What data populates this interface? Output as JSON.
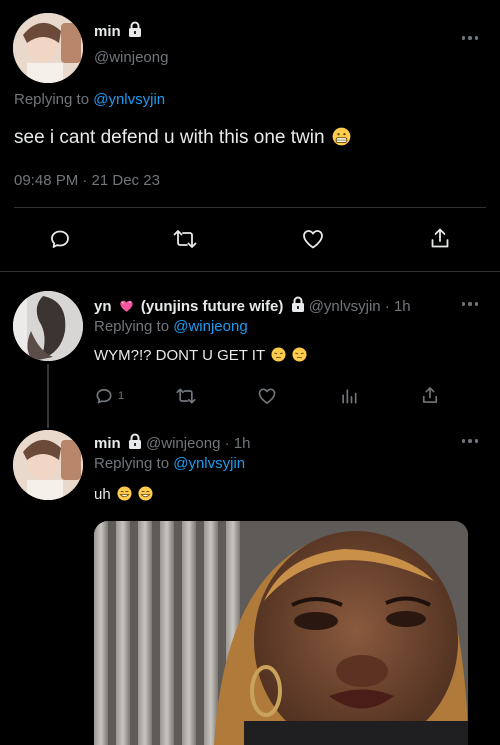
{
  "main_tweet": {
    "display_name": "min",
    "handle": "@winjeong",
    "replying_label": "Replying to",
    "replying_handle": "@ynlvsyjin",
    "text": "see i cant defend u with this one twin",
    "timestamp": "09:48 PM · 21 Dec 23"
  },
  "reply1": {
    "display_name": "yn",
    "name_suffix": "(yunjins future wife)",
    "handle": "@ynlvsyjin",
    "time": "· 1h",
    "replying_label": "Replying to",
    "replying_handle": "@winjeong",
    "text": "WYM?!? DONT U GET IT",
    "reply_count": "1"
  },
  "reply2": {
    "display_name": "min",
    "handle": "@winjeong",
    "time": "· 1h",
    "replying_label": "Replying to",
    "replying_handle": "@ynlvsyjin",
    "text": "uh"
  },
  "colors": {
    "background": "#000000",
    "text": "#e7e9ea",
    "muted": "#71767b",
    "link": "#1d9bf0",
    "divider": "#2f3336"
  },
  "icons": [
    "lock-icon",
    "more-icon",
    "reply-icon",
    "retweet-icon",
    "like-icon",
    "share-icon",
    "analytics-icon",
    "pink-heart-icon",
    "grimace-emoji-icon",
    "pensive-emoji-icon",
    "grin-emoji-icon"
  ]
}
